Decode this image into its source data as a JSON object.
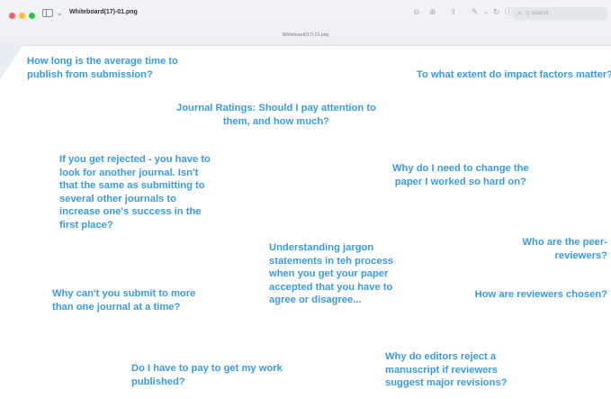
{
  "window": {
    "title": "Whiteboard(17)-01.png",
    "subtitle": "Whiteboard(17)-01.png",
    "search_placeholder": "Q Search"
  },
  "toolbar": {
    "icons": [
      "zoom-out-icon",
      "zoom-in-icon",
      "share-icon",
      "markup-icon",
      "chevron-icon",
      "rotate-icon",
      "info-icon"
    ]
  },
  "notes": [
    {
      "text": "How long is the average time to\npublish from submission?"
    },
    {
      "text": "To what extent do impact factors matter?"
    },
    {
      "text": "Journal Ratings: Should I pay attention to\nthem, and how much?"
    },
    {
      "text": "If you get rejected - you have to\nlook for another journal. Isn't\nthat the same as submitting to\nseveral other journals to\nincrease one's success in the\nfirst place?"
    },
    {
      "text": "Why do I need to change the\npaper I worked so hard on?"
    },
    {
      "text": "Who are the peer-\nreviewers?"
    },
    {
      "text": "Understanding jargon\nstatements in teh process\nwhen you get your paper\naccepted that you have to\nagree or disagree..."
    },
    {
      "text": "Why can't you submit to more\nthan one journal at a time?"
    },
    {
      "text": "How are reviewers chosen?"
    },
    {
      "text": "Do I have to pay to get my work\npublished?"
    },
    {
      "text": "Why do editors reject a\nmanuscript if reviewers\nsuggest major revisions?"
    }
  ],
  "colors": {
    "note_text": "#3a9be0",
    "titlebar": "#eceef1"
  }
}
